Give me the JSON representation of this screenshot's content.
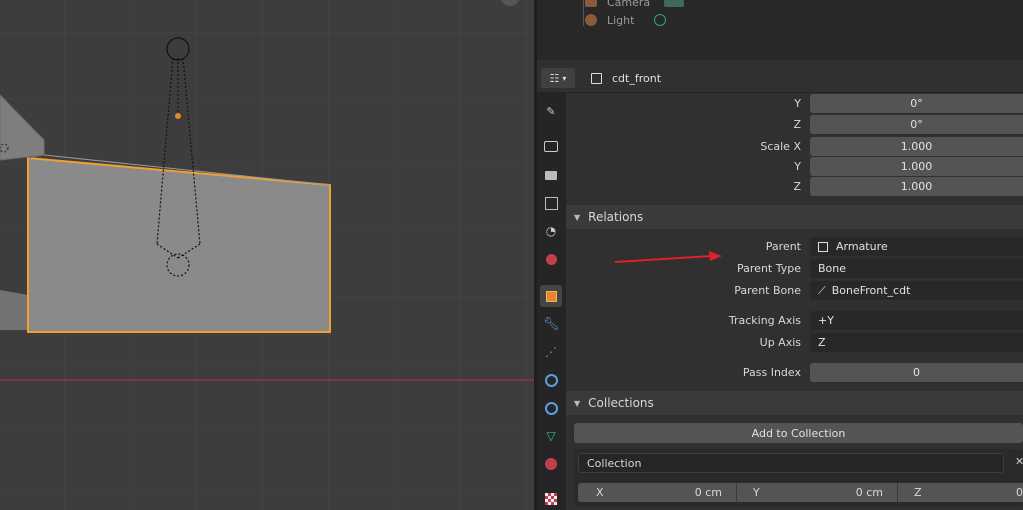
{
  "outliner": {
    "items": [
      {
        "label": "Camera",
        "icon": "camera-icon"
      },
      {
        "label": "Light",
        "icon": "light-icon"
      }
    ]
  },
  "properties": {
    "object_name": "cdt_front",
    "editor_type_icon": "properties-editor-icon",
    "transform": {
      "rotation_y_label": "Y",
      "rotation_y": "0°",
      "rotation_z_label": "Z",
      "rotation_z": "0°",
      "scale_x_label": "Scale X",
      "scale_x": "1.000",
      "scale_y_label": "Y",
      "scale_y": "1.000",
      "scale_z_label": "Z",
      "scale_z": "1.000"
    },
    "relations": {
      "title": "Relations",
      "parent_label": "Parent",
      "parent_value": "Armature",
      "parent_type_label": "Parent Type",
      "parent_type_value": "Bone",
      "parent_bone_label": "Parent Bone",
      "parent_bone_value": "BoneFront_cdt",
      "tracking_axis_label": "Tracking Axis",
      "tracking_axis_value": "+Y",
      "up_axis_label": "Up Axis",
      "up_axis_value": "Z",
      "pass_index_label": "Pass Index",
      "pass_index_value": "0"
    },
    "collections": {
      "title": "Collections",
      "add_button": "Add to Collection",
      "collection_name": "Collection",
      "close_glyph": "✕",
      "offset_x_label": "X",
      "offset_x": "0 cm",
      "offset_y_label": "Y",
      "offset_y": "0 cm",
      "offset_z_label": "Z",
      "offset_z": "0"
    }
  },
  "colors": {
    "selection_outline": "#f0a030",
    "annotation_arrow": "#e0202a",
    "active_tab_accent": "#e8852a"
  }
}
